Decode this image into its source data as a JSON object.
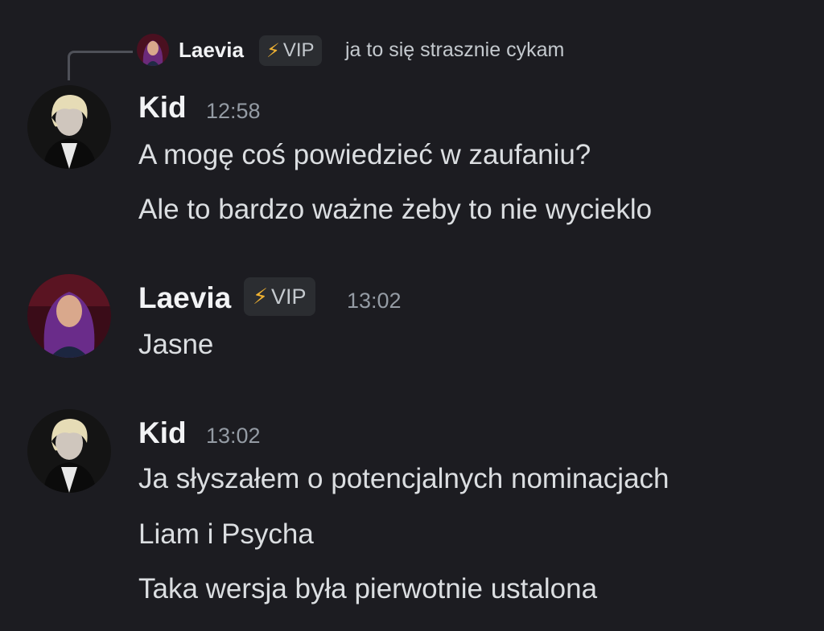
{
  "reply": {
    "author": "Laevia",
    "badge_icon": "lightning-bolt-icon",
    "badge_label": "VIP",
    "text": "ja to się strasznie cykam"
  },
  "messages": [
    {
      "author": "Kid",
      "timestamp": "12:58",
      "lines": [
        "A mogę coś powiedzieć w zaufaniu?",
        "Ale to bardzo ważne żeby to nie wycieklo"
      ]
    },
    {
      "author": "Laevia",
      "badge_icon": "lightning-bolt-icon",
      "badge_label": "VIP",
      "timestamp": "13:02",
      "lines": [
        "Jasne"
      ]
    },
    {
      "author": "Kid",
      "timestamp": "13:02",
      "lines": [
        "Ja słyszałem o potencjalnych nominacjach",
        "Liam i Psycha",
        "Taka wersja była pierwotnie ustalona"
      ]
    }
  ],
  "colors": {
    "background": "#1c1c21",
    "username": "#f2f3f5",
    "text": "#dbdee1",
    "timestamp": "#949ba4",
    "badge_bg": "#2b2d31",
    "bolt": "#f0b232"
  }
}
